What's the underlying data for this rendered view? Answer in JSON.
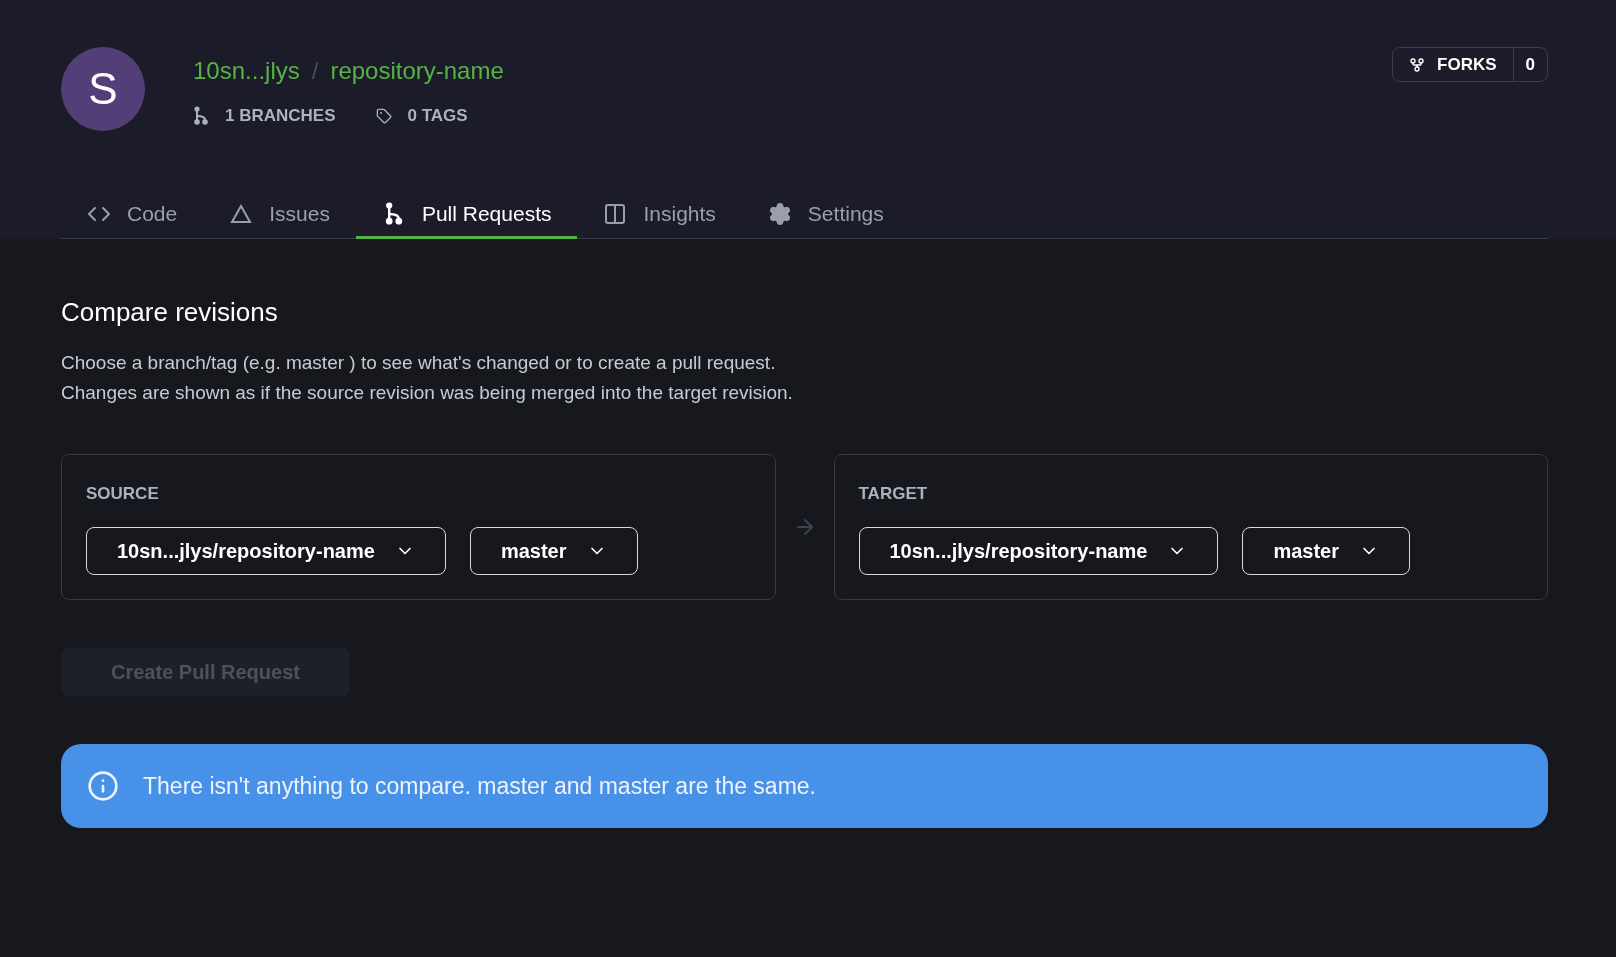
{
  "repo": {
    "avatar_letter": "S",
    "owner": "10sn...jlys",
    "separator": "/",
    "name": "repository-name",
    "branches": "1 BRANCHES",
    "tags": "0 TAGS"
  },
  "forks": {
    "label": "FORKS",
    "count": "0"
  },
  "tabs": [
    {
      "kind": "code",
      "label": "Code",
      "selected": false
    },
    {
      "kind": "issues",
      "label": "Issues",
      "selected": false
    },
    {
      "kind": "pull",
      "label": "Pull Requests",
      "selected": true
    },
    {
      "kind": "insights",
      "label": "Insights",
      "selected": false
    },
    {
      "kind": "settings",
      "label": "Settings",
      "selected": false
    }
  ],
  "compare": {
    "title": "Compare revisions",
    "lines": [
      "Choose a branch/tag (e.g. master ) to see what's changed or to create a pull request.",
      "Changes are shown as if the source revision was being merged into the target revision."
    ]
  },
  "panels": [
    {
      "label": "SOURCE",
      "repo": "10sn...jlys/repository-name",
      "branch": "master"
    },
    {
      "label": "TARGET",
      "repo": "10sn...jlys/repository-name",
      "branch": "master"
    }
  ],
  "create_button": {
    "label": "Create Pull Request",
    "disabled": true
  },
  "alert": {
    "text": "There isn't anything to compare. master and master are the same."
  }
}
